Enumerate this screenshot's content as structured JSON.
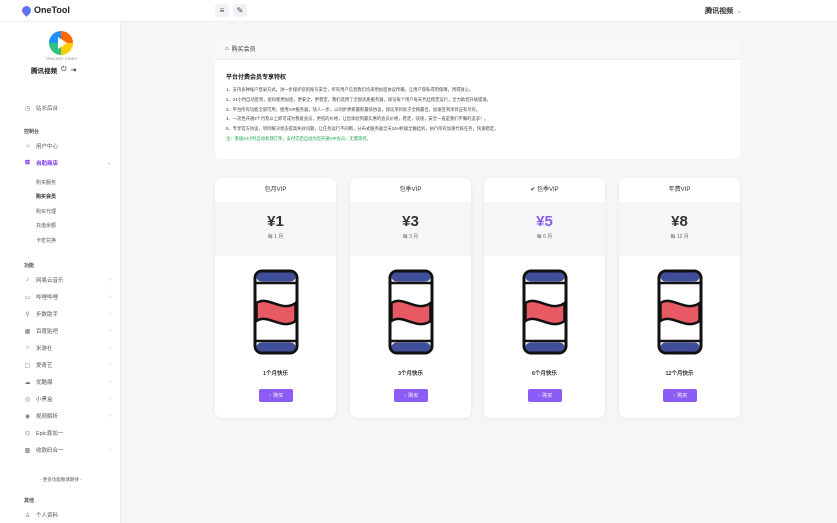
{
  "brand": {
    "name": "OneTool"
  },
  "toolbar": {
    "menu_icon": "≡",
    "pen_icon": "✎"
  },
  "user_menu": {
    "label": "腾讯视频",
    "caret": "⌄"
  },
  "sidebar": {
    "logo_caption": "TENCENT VIDEO",
    "profile_name": "腾讯视频",
    "top_item": "站长后台",
    "section_account": "控制台",
    "account_items": [
      "用户中心",
      "自助商店"
    ],
    "sub_items": [
      "购买服务",
      "购买会员",
      "购买代理",
      "充值余额",
      "卡密兑换"
    ],
    "section_features": "功能",
    "feature_items": [
      "网易云音乐",
      "哔哩哔哩",
      "步数助手",
      "百度贴吧",
      "米游社",
      "爱奇艺",
      "优酷爆",
      "小黑盒",
      "视频解析",
      "Epic喜加一",
      "收款码合一"
    ],
    "more": "- 更多功能敬请期待 -",
    "section_other": "其他",
    "other_items": [
      "个人资料"
    ]
  },
  "panel": {
    "header": "购买会员",
    "perks_title": "平台付费会员专享特权",
    "perks": [
      "1、支持多种账户登录方式，进一步保护您的账号安全，所有用户信息我们均采用加密协议传输，让用户隐私得到保障，用得放心。",
      "2、24小时自动签到，密码使用加密，更安全，更稳定，我们选用了全国优质服务器，保证每个用户每天代挂稳定运行，全力助您升级提速。",
      "3、平台所有功能全部可用，使用VIP服务器，快人一步，以同步更新最新最快协议，保证项目处于全网最佳，加速签到项目应有尽有。",
      "4、一次性开通3个月及以上即可成为我爱会员，更低的价格，让您体验到最实惠的会员价格，稳定，快速，安全一直是我们不懈的追求！。",
      "5、专享官方协议，项目解决状态提高失效问题，让任务运行不间断，分布式服务器全天24H秒级全触挂机，执行所有加速代练任务，快速稳定。"
    ],
    "note": "注：系统24小时自动处理订单，支付完后自动为您开通VIP会员，无需等待。"
  },
  "plans": [
    {
      "name": "包月VIP",
      "price": "¥1",
      "period": "每 1 月",
      "caption": "1个月快乐",
      "buy": "购买",
      "featured": false
    },
    {
      "name": "包季VIP",
      "price": "¥3",
      "period": "每 3 月",
      "caption": "3个月快乐",
      "buy": "购买",
      "featured": false
    },
    {
      "name": "✔ 包季VIP",
      "price": "¥5",
      "period": "每 6 月",
      "caption": "6个月快乐",
      "buy": "购买",
      "featured": true
    },
    {
      "name": "年费VIP",
      "price": "¥8",
      "period": "每 12 月",
      "caption": "12个月快乐",
      "buy": "购买",
      "featured": false
    }
  ],
  "colors": {
    "accent": "#8b5cf6",
    "can_blue": "#3f4f99",
    "can_red": "#e85a63"
  }
}
